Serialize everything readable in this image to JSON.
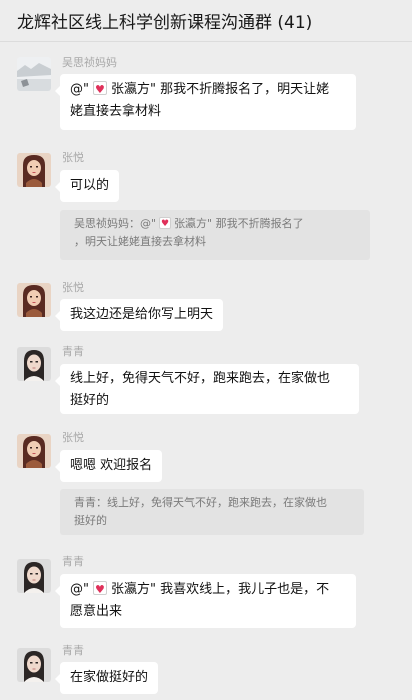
{
  "header": {
    "title": "龙辉社区线上科学创新课程沟通群 (41)"
  },
  "messages": [
    {
      "sender": "吴思祯妈妈",
      "avatar": "avatar-snow-photo-icon",
      "mention": "@\"",
      "mention_name": "张瀛方\"",
      "line1": "那我不折腾报名了，明天让姥",
      "line2": "姥直接去拿材料"
    },
    {
      "sender": "张悦",
      "avatar": "avatar-girl-illustration-icon",
      "text": "可以的",
      "quote": {
        "prefix": "吴思祯妈妈：@\"",
        "name": "张瀛方\"",
        "line1": "那我不折腾报名了",
        "line2": "，明天让姥姥直接去拿材料"
      }
    },
    {
      "sender": "张悦",
      "avatar": "avatar-girl-illustration-icon",
      "text": "我这边还是给你写上明天"
    },
    {
      "sender": "青青",
      "avatar": "avatar-woman-photo-icon",
      "line1": "线上好，免得天气不好，跑来跑去，在家做也",
      "line2": "挺好的"
    },
    {
      "sender": "张悦",
      "avatar": "avatar-girl-illustration-icon",
      "text": "嗯嗯 欢迎报名",
      "quote": {
        "line1": "青青：线上好，免得天气不好，跑来跑去，在家做也",
        "line2": "挺好的"
      }
    },
    {
      "sender": "青青",
      "avatar": "avatar-woman-photo-icon",
      "mention": "@\"",
      "mention_name": "张瀛方\"",
      "line1": "我喜欢线上，我儿子也是，不",
      "line2": "愿意出来"
    },
    {
      "sender": "青青",
      "avatar": "avatar-woman-photo-icon",
      "text": "在家做挺好的"
    }
  ],
  "colors": {
    "background": "#ededed",
    "bubble": "#ffffff",
    "quote": "#e3e3e3",
    "sender": "#a8a8a8"
  }
}
